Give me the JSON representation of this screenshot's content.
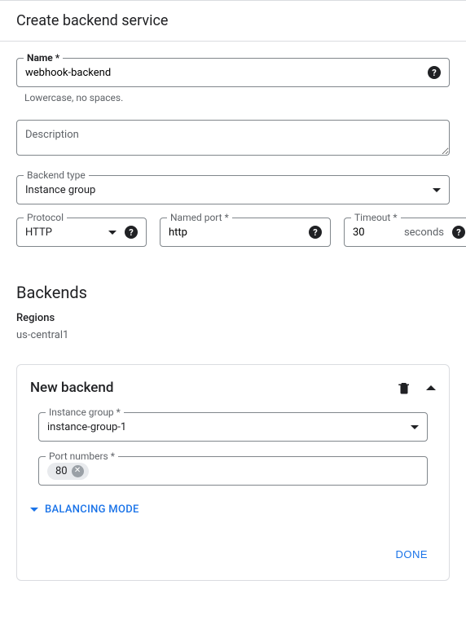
{
  "header": {
    "title": "Create backend service"
  },
  "name": {
    "label": "Name *",
    "value": "webhook-backend",
    "helper": "Lowercase, no spaces."
  },
  "description": {
    "placeholder": "Description",
    "value": ""
  },
  "backend_type": {
    "label": "Backend type",
    "value": "Instance group"
  },
  "protocol": {
    "label": "Protocol",
    "value": "HTTP"
  },
  "named_port": {
    "label": "Named port *",
    "value": "http"
  },
  "timeout": {
    "label": "Timeout *",
    "value": "30",
    "unit": "seconds"
  },
  "backends": {
    "heading": "Backends",
    "regions_label": "Regions",
    "regions_value": "us-central1"
  },
  "new_backend": {
    "title": "New backend",
    "instance_group": {
      "label": "Instance group *",
      "value": "instance-group-1"
    },
    "port_numbers": {
      "label": "Port numbers *",
      "chips": [
        "80"
      ]
    },
    "balancing_mode_label": "BALANCING MODE",
    "done_label": "DONE"
  }
}
